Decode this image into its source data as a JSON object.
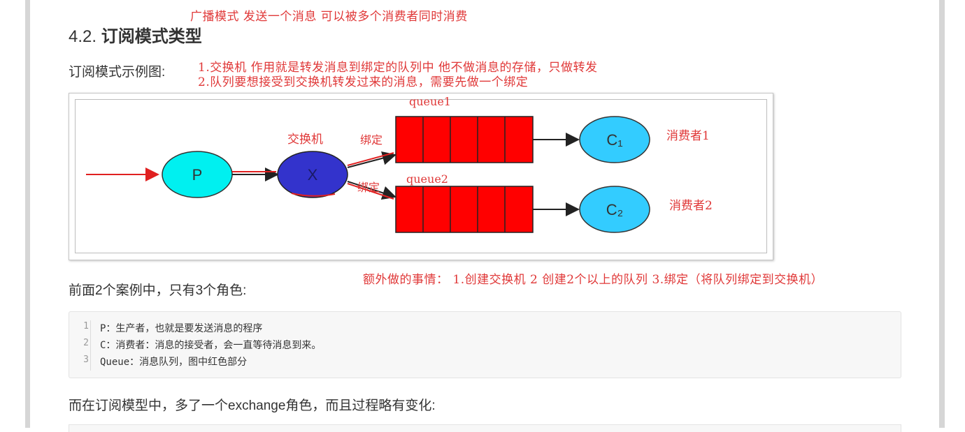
{
  "annotations": {
    "broadcast": "广播模式   发送一个消息 可以被多个消费者同时消费",
    "note1": "1.交换机 作用就是转发消息到绑定的队列中 他不做消息的存储，只做转发",
    "note2": "2.队列要想接受到交换机转发过来的消息，需要先做一个绑定",
    "extra": "额外做的事情：  1.创建交换机 2 创建2个以上的队列 3.绑定（将队列绑定到交换机）"
  },
  "heading": {
    "num": "4.2.",
    "text": "订阅模式类型"
  },
  "para_example": "订阅模式示例图:",
  "para_roles": "前面2个案例中，只有3个角色:",
  "para_change": "而在订阅模型中，多了一个exchange角色，而且过程略有变化:",
  "diagram": {
    "producer": "P",
    "exchange": "X",
    "consumer1": "C₁",
    "consumer2": "C₂",
    "queue1": "queue1",
    "queue2": "queue2",
    "exchange_label": "交换机",
    "bind1": "绑定",
    "bind2": "绑定",
    "consumer1_label": "消费者1",
    "consumer2_label": "消费者2",
    "colors": {
      "producer": "#00f0f0",
      "exchange": "#3333cc",
      "queue": "#ff0000",
      "consumer": "#33ccff",
      "annotation": "#e03838"
    }
  },
  "code": {
    "lines": [
      {
        "num": "1",
        "text": "P：生产者，也就是要发送消息的程序"
      },
      {
        "num": "2",
        "text": "C：消费者：消息的接受者，会一直等待消息到来。"
      },
      {
        "num": "3",
        "text": "Queue：消息队列，图中红色部分"
      }
    ]
  }
}
